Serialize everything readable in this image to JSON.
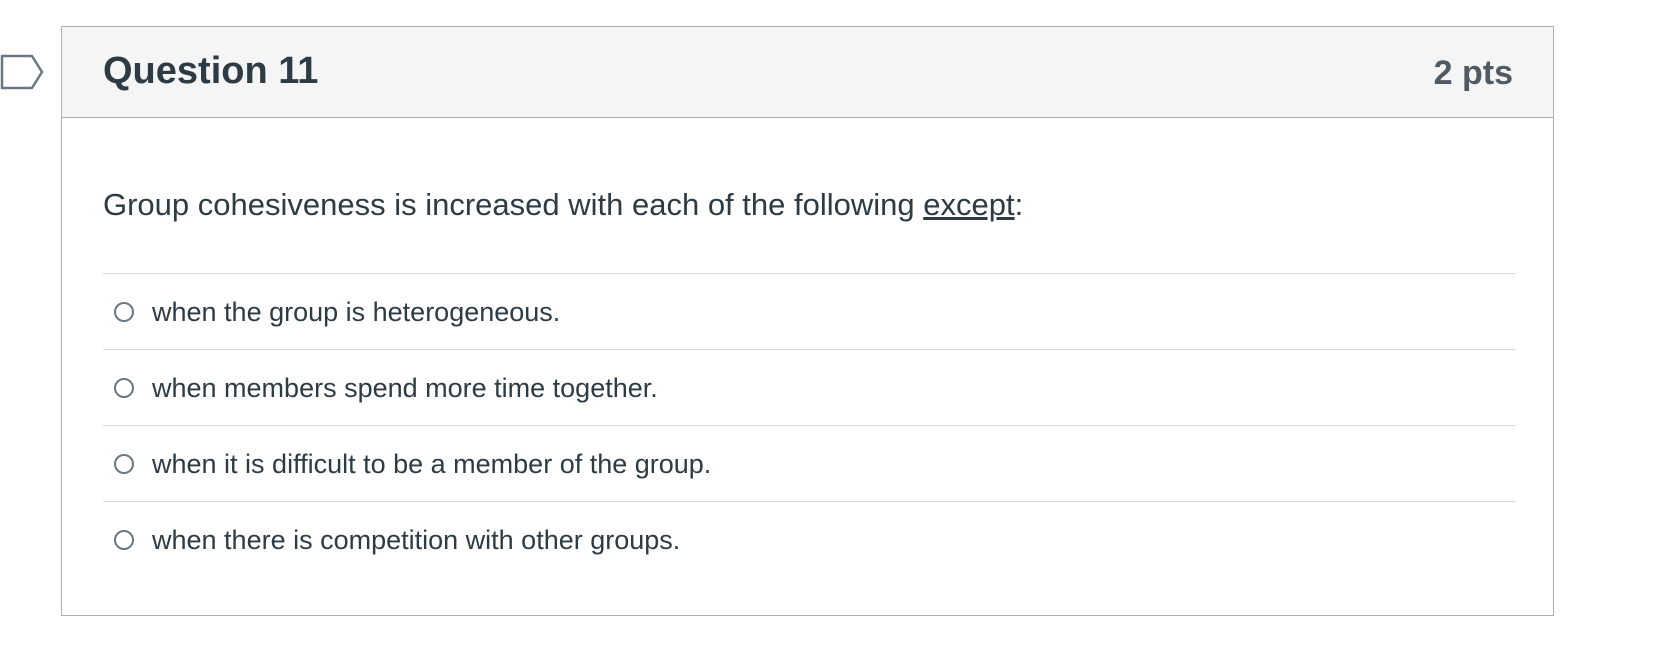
{
  "flag": {
    "icon": "flag-icon",
    "color": "#6b7780"
  },
  "question": {
    "title": "Question 11",
    "points": "2 pts",
    "text_before": "Group cohesiveness is increased with each of the following ",
    "text_emphasis": "except",
    "text_after": ":"
  },
  "answers": [
    {
      "label": "when the group is heterogeneous.",
      "selected": false
    },
    {
      "label": "when members spend more time together.",
      "selected": false
    },
    {
      "label": "when it is difficult to be a member of the group.",
      "selected": false
    },
    {
      "label": "when there is competition with other groups.",
      "selected": false
    }
  ],
  "colors": {
    "text": "#2d3b45",
    "border": "#a9b0b6",
    "header_bg": "#f5f5f5",
    "divider": "#d7dbdf"
  }
}
